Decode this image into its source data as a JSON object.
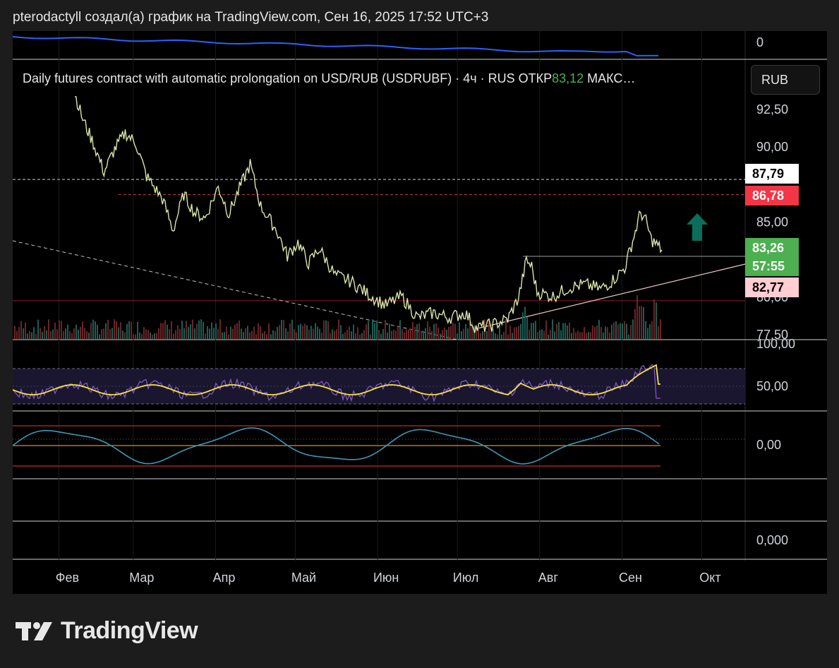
{
  "header": {
    "text": "pterodactyll создал(а) график на TradingView.com, Сен 16, 2025 17:52 UTC+3"
  },
  "symbol": {
    "description": "Daily futures contract with automatic prolongation on USD/RUB (USDRUBF) · 4ч · RUS  ОТКР",
    "open_value": "83,12",
    "suffix": "  МАКС…"
  },
  "currency": "RUB",
  "colors": {
    "up": "#26a69a",
    "down": "#ef5350",
    "candle_line": "#d8e6a8",
    "rsi": "#7e57c2",
    "rsi_ma": "#f5e33b",
    "osc": "#3f96b5",
    "top_line": "#2962ff",
    "accent_green": "#4caf50",
    "accent_red": "#f23645",
    "pink": "#ffcdd2"
  },
  "price_tags": [
    {
      "label": "87,79",
      "bg": "#ffffff",
      "fg": "#000000"
    },
    {
      "label": "86,78",
      "bg": "#f23645",
      "fg": "#ffffff"
    },
    {
      "label": "83,26",
      "bg": "#4caf50",
      "fg": "#ffffff"
    },
    {
      "label": "57:55",
      "bg": "#4caf50",
      "fg": "#ffffff"
    },
    {
      "label": "82,77",
      "bg": "#ffcdd2",
      "fg": "#000000"
    }
  ],
  "pane_labels": {
    "top": "0",
    "rsi_top": "100,00",
    "rsi_mid": "50,00",
    "osc": "0,00",
    "bottom": "0,000"
  },
  "brand": {
    "name": "TradingView"
  },
  "chart_data": {
    "type": "line",
    "title": "Daily futures contract with automatic prolongation on USD/RUB (USDRUBF) · 4ч · RUS",
    "x_labels": [
      "Фев",
      "Мар",
      "Апр",
      "Май",
      "Июн",
      "Июл",
      "Авг",
      "Сен",
      "Окт"
    ],
    "y_ticks": [
      "92,50",
      "90,00",
      "85,00",
      "80,00",
      "77,50"
    ],
    "ylim": [
      77.5,
      93.5
    ],
    "months": [
      "2025-02",
      "2025-03",
      "2025-04",
      "2025-05",
      "2025-06",
      "2025-07",
      "2025-08",
      "2025-09"
    ],
    "price_series": [
      [
        "2025-02-07",
        93.5
      ],
      [
        "2025-02-10",
        91.8
      ],
      [
        "2025-02-14",
        90.2
      ],
      [
        "2025-02-18",
        88.3
      ],
      [
        "2025-02-22",
        89.8
      ],
      [
        "2025-02-26",
        90.9
      ],
      [
        "2025-03-02",
        90.2
      ],
      [
        "2025-03-06",
        88.0
      ],
      [
        "2025-03-12",
        86.5
      ],
      [
        "2025-03-16",
        84.4
      ],
      [
        "2025-03-20",
        86.8
      ],
      [
        "2025-03-24",
        85.6
      ],
      [
        "2025-03-28",
        85.2
      ],
      [
        "2025-04-02",
        87.3
      ],
      [
        "2025-04-06",
        85.5
      ],
      [
        "2025-04-10",
        87.2
      ],
      [
        "2025-04-14",
        88.8
      ],
      [
        "2025-04-18",
        86.0
      ],
      [
        "2025-04-24",
        84.4
      ],
      [
        "2025-04-28",
        82.7
      ],
      [
        "2025-05-02",
        83.6
      ],
      [
        "2025-05-06",
        82.2
      ],
      [
        "2025-05-10",
        83.2
      ],
      [
        "2025-05-16",
        81.4
      ],
      [
        "2025-05-22",
        81.0
      ],
      [
        "2025-05-28",
        80.2
      ],
      [
        "2025-06-04",
        79.4
      ],
      [
        "2025-06-10",
        80.0
      ],
      [
        "2025-06-16",
        78.6
      ],
      [
        "2025-06-22",
        78.9
      ],
      [
        "2025-06-28",
        78.6
      ],
      [
        "2025-07-04",
        78.9
      ],
      [
        "2025-07-08",
        77.9
      ],
      [
        "2025-07-14",
        78.1
      ],
      [
        "2025-07-20",
        78.5
      ],
      [
        "2025-07-24",
        79.9
      ],
      [
        "2025-07-27",
        82.4
      ],
      [
        "2025-07-29",
        82.0
      ],
      [
        "2025-07-31",
        80.3
      ],
      [
        "2025-08-06",
        80.0
      ],
      [
        "2025-08-12",
        80.6
      ],
      [
        "2025-08-18",
        80.8
      ],
      [
        "2025-08-24",
        80.5
      ],
      [
        "2025-08-28",
        81.0
      ],
      [
        "2025-09-02",
        81.9
      ],
      [
        "2025-09-05",
        83.7
      ],
      [
        "2025-09-08",
        85.6
      ],
      [
        "2025-09-10",
        85.0
      ],
      [
        "2025-09-12",
        83.8
      ],
      [
        "2025-09-16",
        83.1
      ]
    ],
    "levels": {
      "dashed_white": 87.79,
      "dashed_red": 86.78,
      "last_close": 83.26,
      "low_marker": 82.77
    }
  }
}
